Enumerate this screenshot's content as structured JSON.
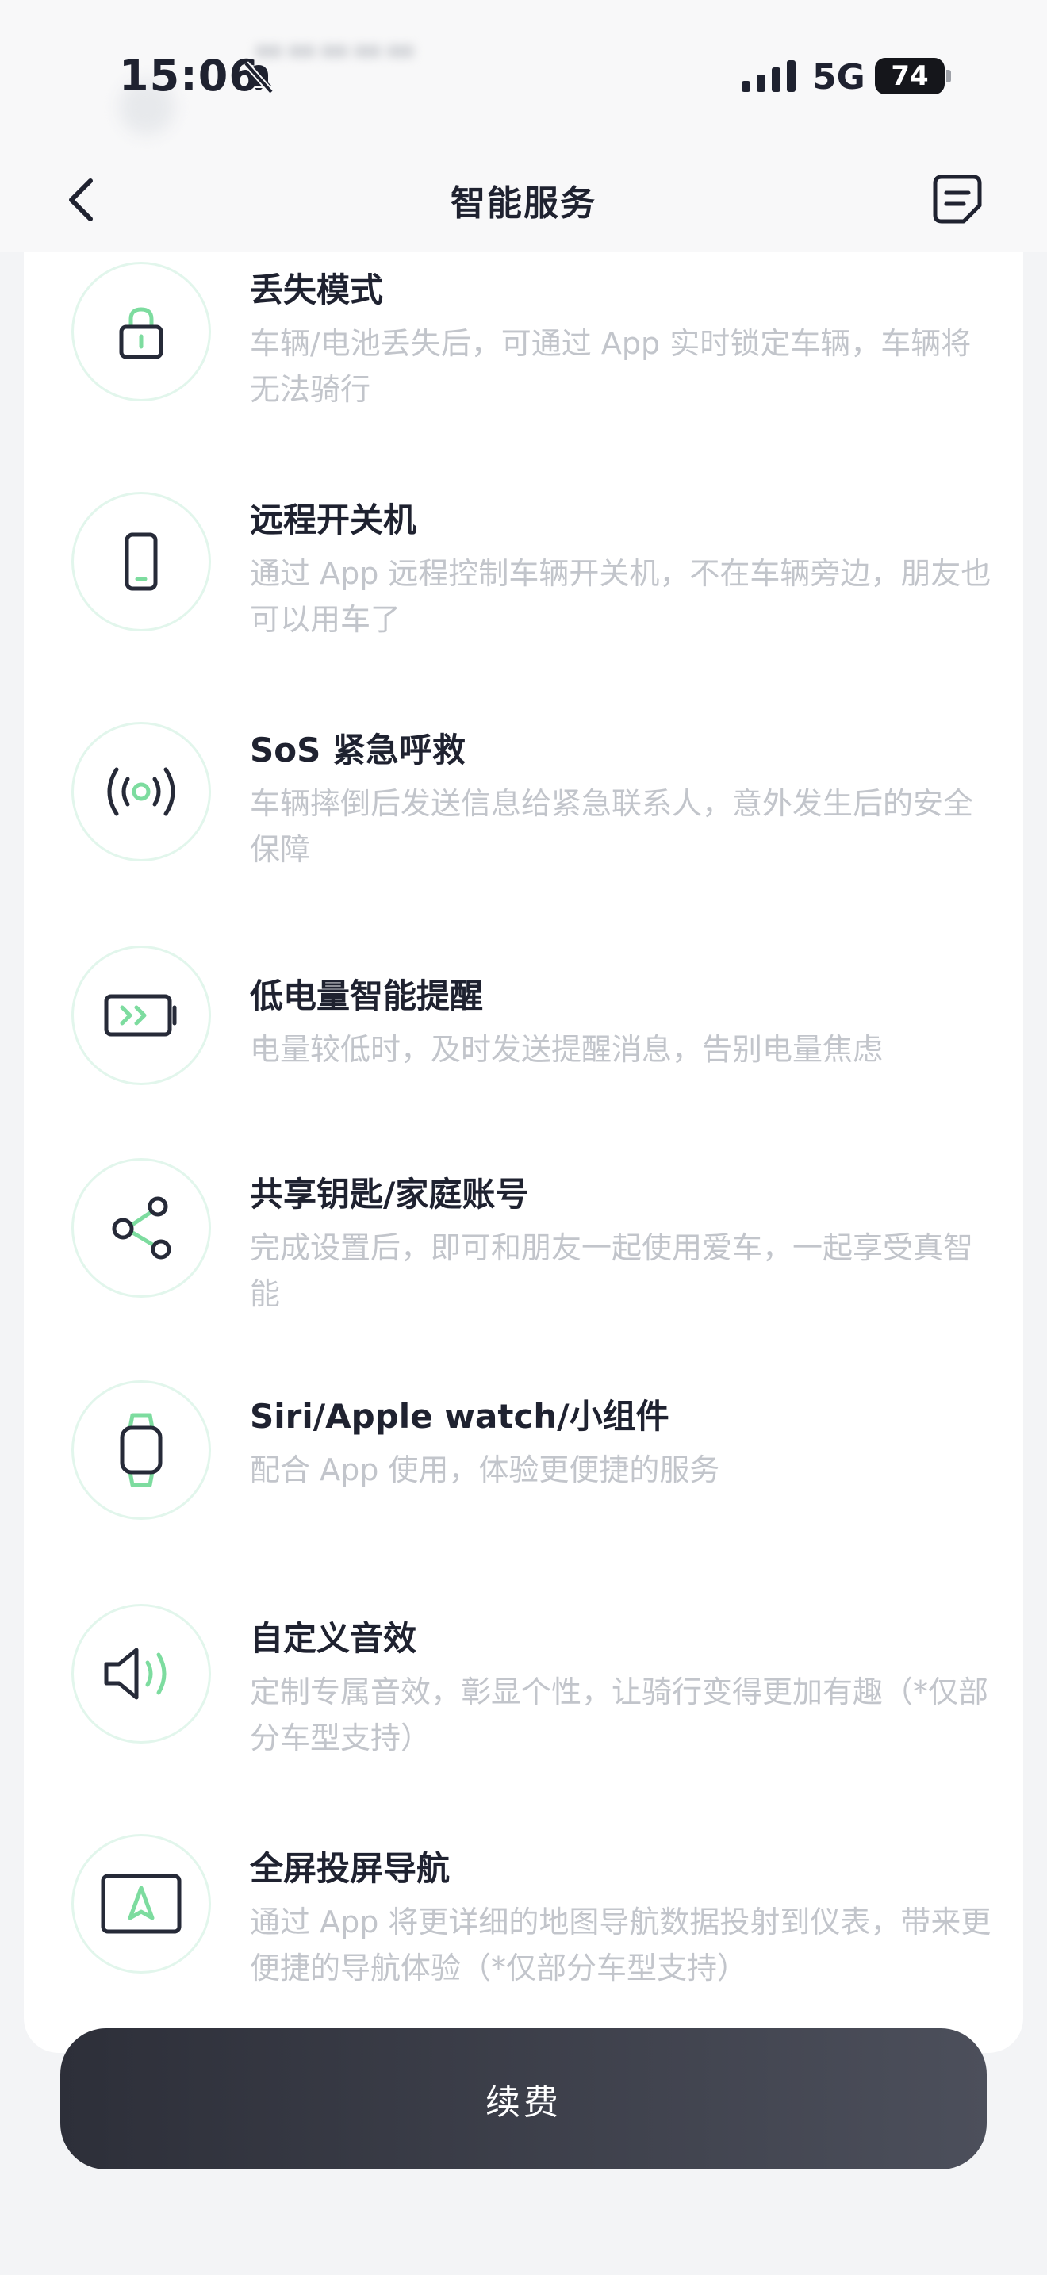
{
  "status_bar": {
    "time": "15:06",
    "network": "5G",
    "battery": "74"
  },
  "header": {
    "title": "智能服务"
  },
  "services": [
    {
      "title": "丢失模式",
      "desc": "车辆/电池丢失后，可通过 App 实时锁定车辆，车辆将无法骑行",
      "icon": "lock-icon"
    },
    {
      "title": "远程开关机",
      "desc": "通过 App 远程控制车辆开关机，不在车辆旁边，朋友也可以用车了",
      "icon": "phone-icon"
    },
    {
      "title": "SoS 紧急呼救",
      "desc": "车辆摔倒后发送信息给紧急联系人，意外发生后的安全保障",
      "icon": "broadcast-icon"
    },
    {
      "title": "低电量智能提醒",
      "desc": "电量较低时，及时发送提醒消息，告别电量焦虑",
      "icon": "battery-icon"
    },
    {
      "title": "共享钥匙/家庭账号",
      "desc": "完成设置后，即可和朋友一起使用爱车，一起享受真智能",
      "icon": "share-icon"
    },
    {
      "title": "Siri/Apple watch/小组件",
      "desc": "配合 App 使用，体验更便捷的服务",
      "icon": "watch-icon"
    },
    {
      "title": "自定义音效",
      "desc": "定制专属音效，彰显个性，让骑行变得更加有趣（*仅部分车型支持）",
      "icon": "speaker-icon"
    },
    {
      "title": "全屏投屏导航",
      "desc": "通过 App 将更详细的地图导航数据投射到仪表，带来更便捷的导航体验（*仅部分车型支持）",
      "icon": "navigation-icon"
    }
  ],
  "footer": {
    "renew_label": "续费"
  },
  "colors": {
    "accent_green": "#7ddc9f",
    "icon_dark": "#262a38",
    "circle_border": "#e2f6ec"
  }
}
